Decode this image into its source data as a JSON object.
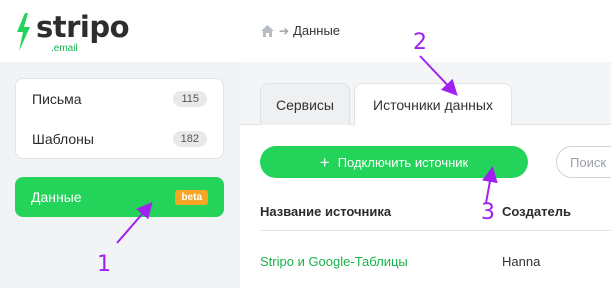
{
  "brand": {
    "name": "stripo",
    "sub": ".email",
    "green": "#24d359",
    "text_dark": "#2d2d2d"
  },
  "breadcrumb": {
    "home_icon": "home-icon",
    "separator": "➔",
    "current": "Данные"
  },
  "sidebar": {
    "items": [
      {
        "label": "Письма",
        "count": "115"
      },
      {
        "label": "Шаблоны",
        "count": "182"
      }
    ],
    "active": {
      "label": "Данные",
      "badge": "beta",
      "badge_color": "#f5a623"
    }
  },
  "tabs": [
    {
      "label": "Сервисы",
      "active": false
    },
    {
      "label": "Источники данных",
      "active": true
    }
  ],
  "toolbar": {
    "connect_label": "Подключить источник",
    "search_placeholder": "Поиск"
  },
  "table": {
    "columns": [
      "Название источника",
      "Создатель"
    ],
    "rows": [
      {
        "name": "Stripo и Google-Таблицы",
        "creator": "Hanna"
      }
    ]
  },
  "annotations": {
    "color": "#a020f0",
    "labels": [
      "1",
      "2",
      "3"
    ]
  }
}
